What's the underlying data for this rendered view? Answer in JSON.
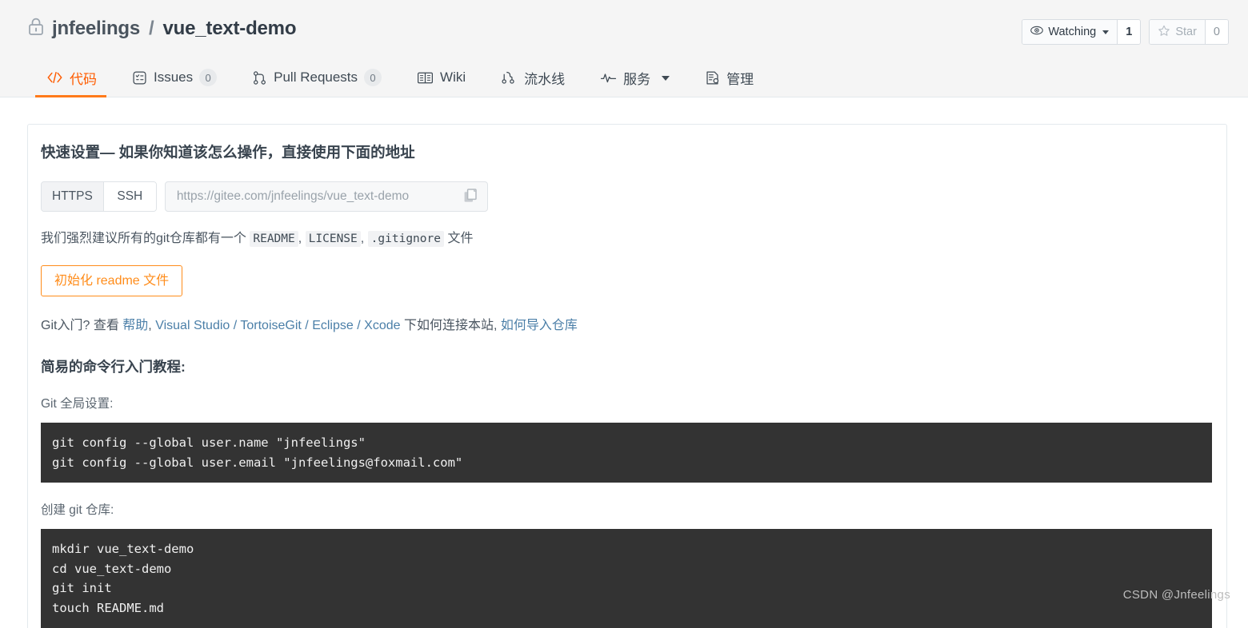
{
  "header": {
    "lock_icon": "lock-icon",
    "owner": "jnfeelings",
    "separator": "/",
    "repo": "vue_text-demo",
    "watch": {
      "icon": "eye-icon",
      "label": "Watching",
      "count": "1"
    },
    "star": {
      "icon": "star-icon",
      "label": "Star",
      "count": "0"
    }
  },
  "nav": {
    "items": [
      {
        "icon": "code-icon",
        "label": "代码",
        "badge": null,
        "active": true,
        "caret": false
      },
      {
        "icon": "issue-icon",
        "label": "Issues",
        "badge": "0",
        "active": false,
        "caret": false
      },
      {
        "icon": "pull-request-icon",
        "label": "Pull Requests",
        "badge": "0",
        "active": false,
        "caret": false
      },
      {
        "icon": "book-icon",
        "label": "Wiki",
        "badge": null,
        "active": false,
        "caret": false
      },
      {
        "icon": "pipeline-icon",
        "label": "流水线",
        "badge": null,
        "active": false,
        "caret": false
      },
      {
        "icon": "service-icon",
        "label": "服务",
        "badge": null,
        "active": false,
        "caret": true
      },
      {
        "icon": "manage-icon",
        "label": "管理",
        "badge": null,
        "active": false,
        "caret": false
      }
    ]
  },
  "quick_setup": {
    "heading": "快速设置— 如果你知道该怎么操作，直接使用下面的地址",
    "protocols": {
      "https": "HTTPS",
      "ssh": "SSH",
      "selected": "SSH"
    },
    "url_value": "https://gitee.com/jnfeelings/vue_text-demo",
    "copy_icon": "copy-icon",
    "recommend_prefix": "我们强烈建议所有的git仓库都有一个",
    "files": {
      "readme": "README",
      "license": "LICENSE",
      "gitignore": ".gitignore"
    },
    "recommend_suffix": "文件",
    "init_readme_button": "初始化 readme 文件",
    "git_intro": {
      "prefix": "Git入门?",
      "view": "查看",
      "help": "帮助",
      "comma1": ",",
      "visual_studio": "Visual Studio",
      "slash1": "/",
      "tortoisegit": "TortoiseGit",
      "slash2": "/",
      "eclipse": "Eclipse",
      "slash3": "/",
      "xcode": "Xcode",
      "middle": "下如何连接本站,",
      "import": "如何导入仓库"
    }
  },
  "tutorial": {
    "heading": "简易的命令行入门教程:",
    "global_label": "Git 全局设置:",
    "global_code": "git config --global user.name \"jnfeelings\"\ngit config --global user.email \"jnfeelings@foxmail.com\"",
    "create_label": "创建 git 仓库:",
    "create_code": "mkdir vue_text-demo\ncd vue_text-demo\ngit init\ntouch README.md"
  },
  "watermark": "CSDN @Jnfeelings",
  "colors": {
    "accent": "#ff7a1a",
    "header_bg": "#f5f5f5",
    "text": "#3f4a54",
    "link": "#4b7fa8",
    "code_bg": "#333333"
  }
}
